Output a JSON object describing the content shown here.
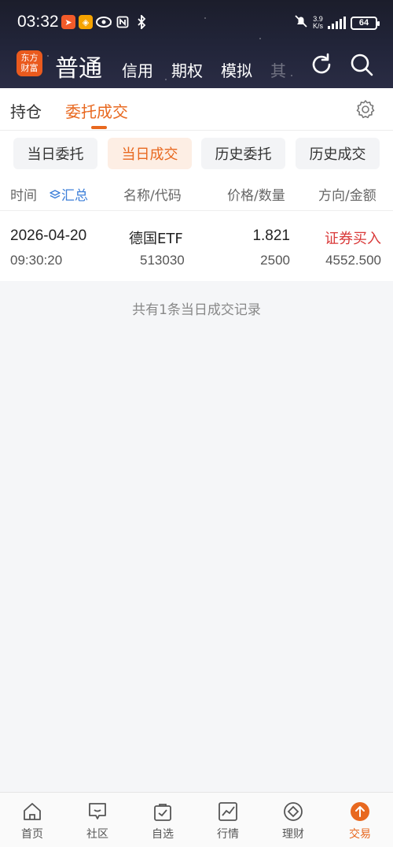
{
  "status_bar": {
    "time": "03:32",
    "net_speed_value": "3.9",
    "net_speed_unit": "K/s",
    "battery": "64"
  },
  "app_bar": {
    "logo_line1": "东方",
    "logo_line2": "财富",
    "mode_title": "普通",
    "nav_items": [
      "信用",
      "期权",
      "模拟",
      "其"
    ]
  },
  "tabs": {
    "holdings": "持仓",
    "orders": "委托成交"
  },
  "subtabs": [
    "当日委托",
    "当日成交",
    "历史委托",
    "历史成交"
  ],
  "active_subtab_index": 1,
  "columns": {
    "time": "时间",
    "summary": "汇总",
    "name_code": "名称/代码",
    "price_qty": "价格/数量",
    "direction_amount": "方向/金额"
  },
  "trades": [
    {
      "date": "2026-04-20",
      "time": "09:30:20",
      "name": "德国ETF",
      "code": "513030",
      "price": "1.821",
      "quantity": "2500",
      "direction": "证券买入",
      "amount": "4552.500"
    }
  ],
  "footer_note": "共有1条当日成交记录",
  "bottom_nav": [
    "首页",
    "社区",
    "自选",
    "行情",
    "理财",
    "交易"
  ],
  "active_bottom_nav": "交易",
  "colors": {
    "accent": "#e8681f",
    "buy_red": "#d93a3a",
    "summary_blue": "#3d7fd9",
    "header_bg": "#1f2133"
  }
}
